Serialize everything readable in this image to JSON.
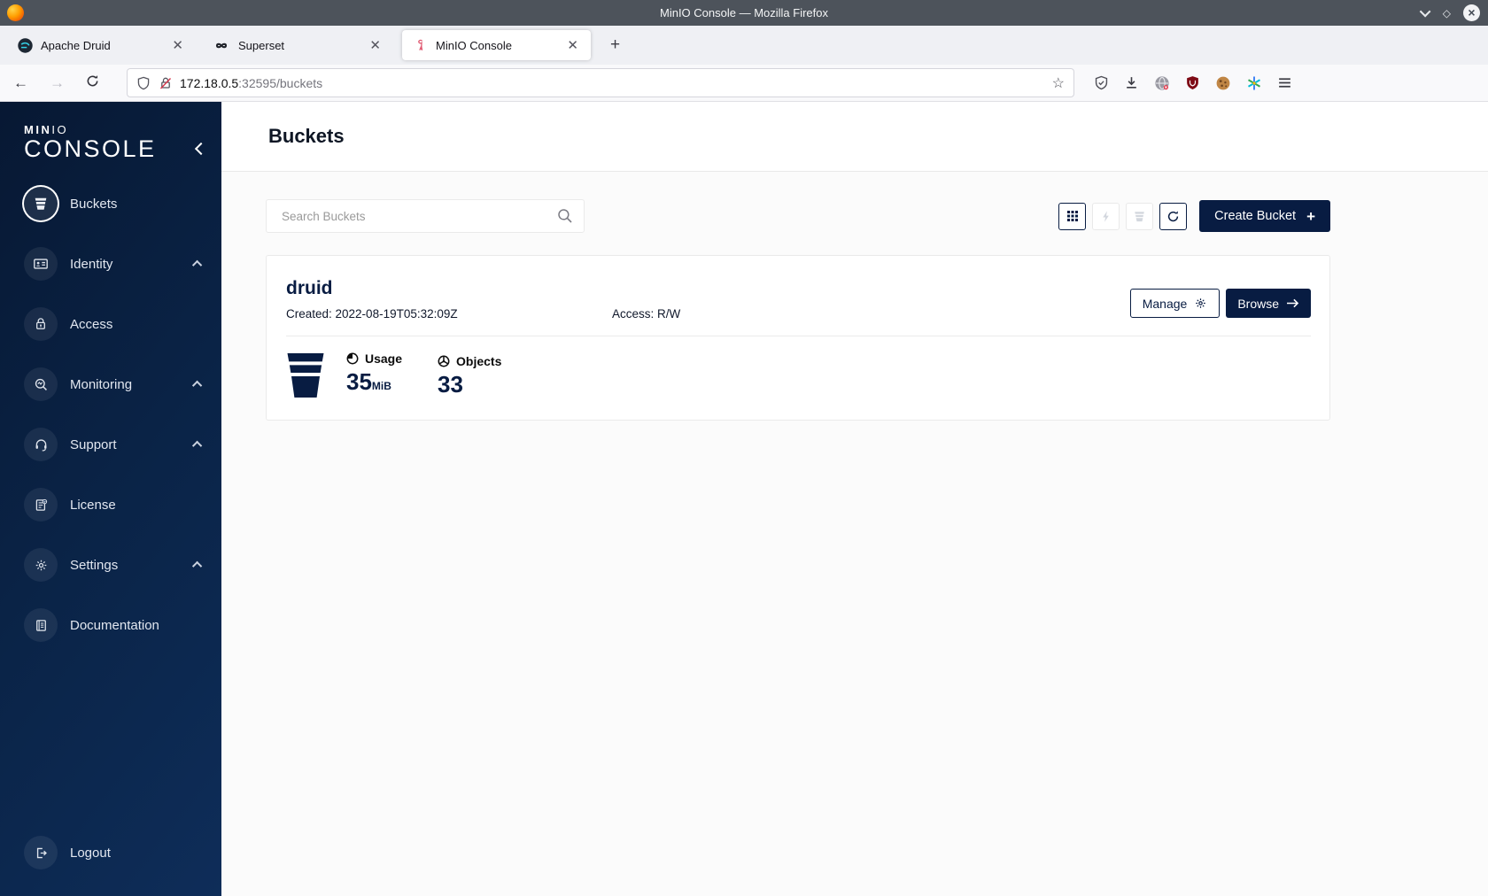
{
  "window": {
    "title": "MinIO Console — Mozilla Firefox"
  },
  "browser": {
    "tabs": [
      {
        "title": "Apache Druid"
      },
      {
        "title": "Superset"
      },
      {
        "title": "MinIO Console"
      }
    ],
    "new_tab_label": "+",
    "url_host": "172.18.0.5",
    "url_rest": ":32595/buckets"
  },
  "sidebar": {
    "logo_bold": "MIN",
    "logo_light": "IO",
    "logo_console": "CONSOLE",
    "items": [
      {
        "label": "Buckets"
      },
      {
        "label": "Identity"
      },
      {
        "label": "Access"
      },
      {
        "label": "Monitoring"
      },
      {
        "label": "Support"
      },
      {
        "label": "License"
      },
      {
        "label": "Settings"
      },
      {
        "label": "Documentation"
      }
    ],
    "logout_label": "Logout"
  },
  "page": {
    "title": "Buckets",
    "search_placeholder": "Search Buckets",
    "create_bucket_label": "Create Bucket"
  },
  "bucket": {
    "name": "druid",
    "created": "Created: 2022-08-19T05:32:09Z",
    "access": "Access: R/W",
    "manage_label": "Manage",
    "browse_label": "Browse",
    "usage_label": "Usage",
    "usage_value": "35",
    "usage_unit": "MiB",
    "objects_label": "Objects",
    "objects_value": "33"
  },
  "colors": {
    "navy": "#081C42",
    "sidebar_gradient_start": "#071833",
    "sidebar_gradient_end": "#0e2d59",
    "content_bg": "#fbfbfb"
  }
}
